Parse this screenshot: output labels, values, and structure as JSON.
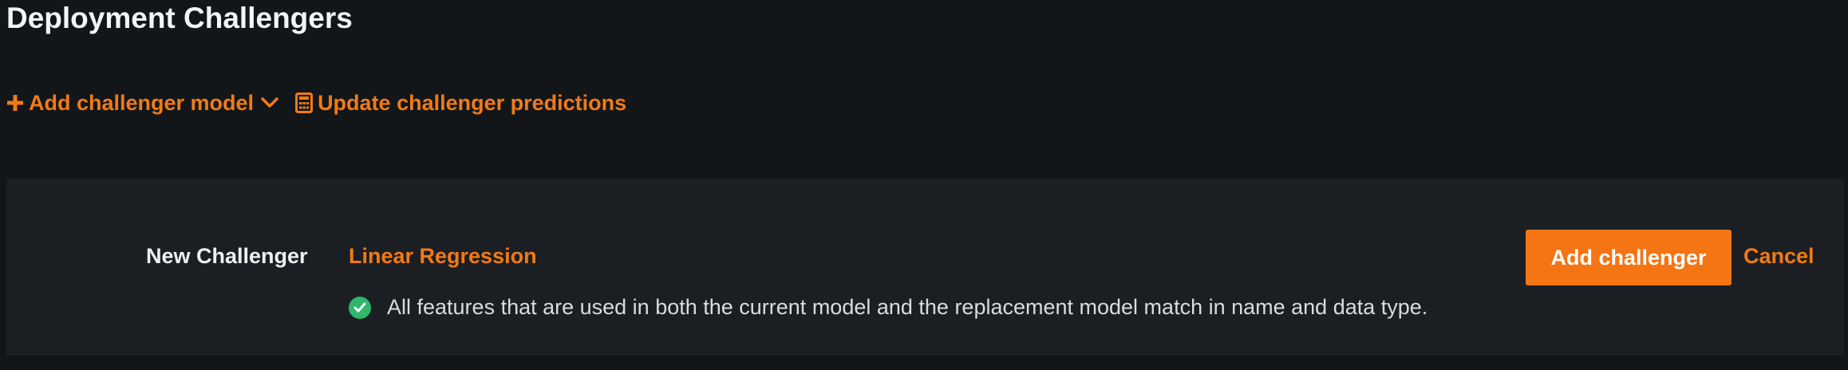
{
  "page": {
    "title": "Deployment Challengers"
  },
  "toolbar": {
    "add_challenger_label": "Add challenger model",
    "update_predictions_label": "Update challenger predictions",
    "add_icon": "plus-icon",
    "dropdown_icon": "chevron-down-icon",
    "update_icon": "calculator-icon"
  },
  "challenger_form": {
    "label": "New Challenger",
    "model_name": "Linear Regression",
    "validation_icon": "check-circle-icon",
    "validation_message": "All features that are used in both the current model and the replacement model match in name and data type.",
    "add_button_label": "Add challenger",
    "cancel_label": "Cancel"
  },
  "colors": {
    "background": "#121619",
    "panel": "#1b1f23",
    "accent": "#f27a14",
    "button": "#f57414",
    "success": "#2fb86a",
    "text": "#eef0f2"
  }
}
